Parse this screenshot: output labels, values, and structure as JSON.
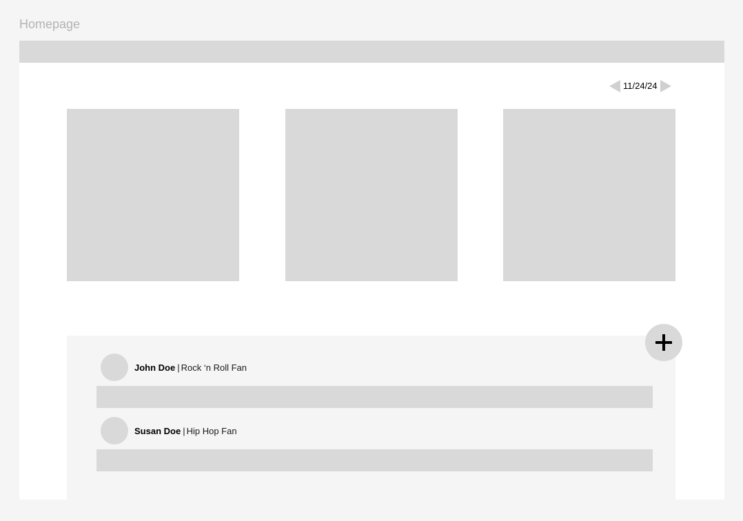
{
  "page": {
    "frame_label": "Homepage"
  },
  "date_nav": {
    "date": "11/24/24",
    "prev_icon": "triangle-left-icon",
    "next_icon": "triangle-right-icon"
  },
  "feed": {
    "add_icon": "plus-icon",
    "posts": [
      {
        "name": "John Doe",
        "separator": "|",
        "tag": "Rock ‘n Roll Fan"
      },
      {
        "name": "Susan Doe",
        "separator": "|",
        "tag": "Hip Hop Fan"
      }
    ]
  },
  "colors": {
    "canvas_bg": "#f5f5f5",
    "frame_bg": "#ffffff",
    "placeholder": "#d9d9d9",
    "label_gray": "#b3b3b3",
    "text": "#000000"
  }
}
